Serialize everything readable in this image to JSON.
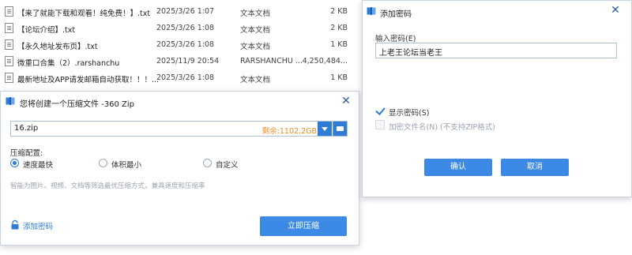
{
  "files": [
    {
      "name": "【来了就能下载和观看！纯免费！】.txt",
      "date": "2025/3/26 1:07",
      "type": "文本文档",
      "size": "2 KB"
    },
    {
      "name": "【论坛介绍】.txt",
      "date": "2025/3/26 1:08",
      "type": "文本文档",
      "size": "2 KB"
    },
    {
      "name": "【永久地址发布页】.txt",
      "date": "2025/3/26 1:08",
      "type": "文本文档",
      "size": "1 KB"
    },
    {
      "name": "微重口合集（2）.rarshanchu",
      "date": "2025/11/9 20:54",
      "type": "RARSHANCHU ...",
      "size": "4,250,484..."
    },
    {
      "name": "最新地址及APP请发邮箱自动获取！！！...",
      "date": "2025/3/26 1:08",
      "type": "文本文档",
      "size": "1 KB"
    }
  ],
  "zip_dialog": {
    "title": "您将创建一个压缩文件 -360 Zip",
    "path_value": "16.zip",
    "free_space": "剩余:1102.2GB",
    "config_label": "压缩配置:",
    "options": [
      {
        "label": "速度最快",
        "checked": true
      },
      {
        "label": "体积最小",
        "checked": false
      },
      {
        "label": "自定义",
        "checked": false
      }
    ],
    "hint": "智能为图片、视频、文档等筛选最优压缩方式，兼具速度和压缩率",
    "add_password": "添加密码",
    "compress_button": "立即压缩"
  },
  "password_dialog": {
    "title": "添加密码",
    "input_label": "输入密码(E)",
    "password_value": "上老王论坛当老王",
    "show_password_label": "显示密码(S)",
    "show_password_checked": true,
    "encrypt_filename_label": "加密文件名(N)  (不支持ZIP格式)",
    "encrypt_filename_checked": false,
    "ok_button": "确认",
    "cancel_button": "取消"
  },
  "colors": {
    "accent": "#3d8ae6",
    "free_space": "#f08a1c"
  }
}
